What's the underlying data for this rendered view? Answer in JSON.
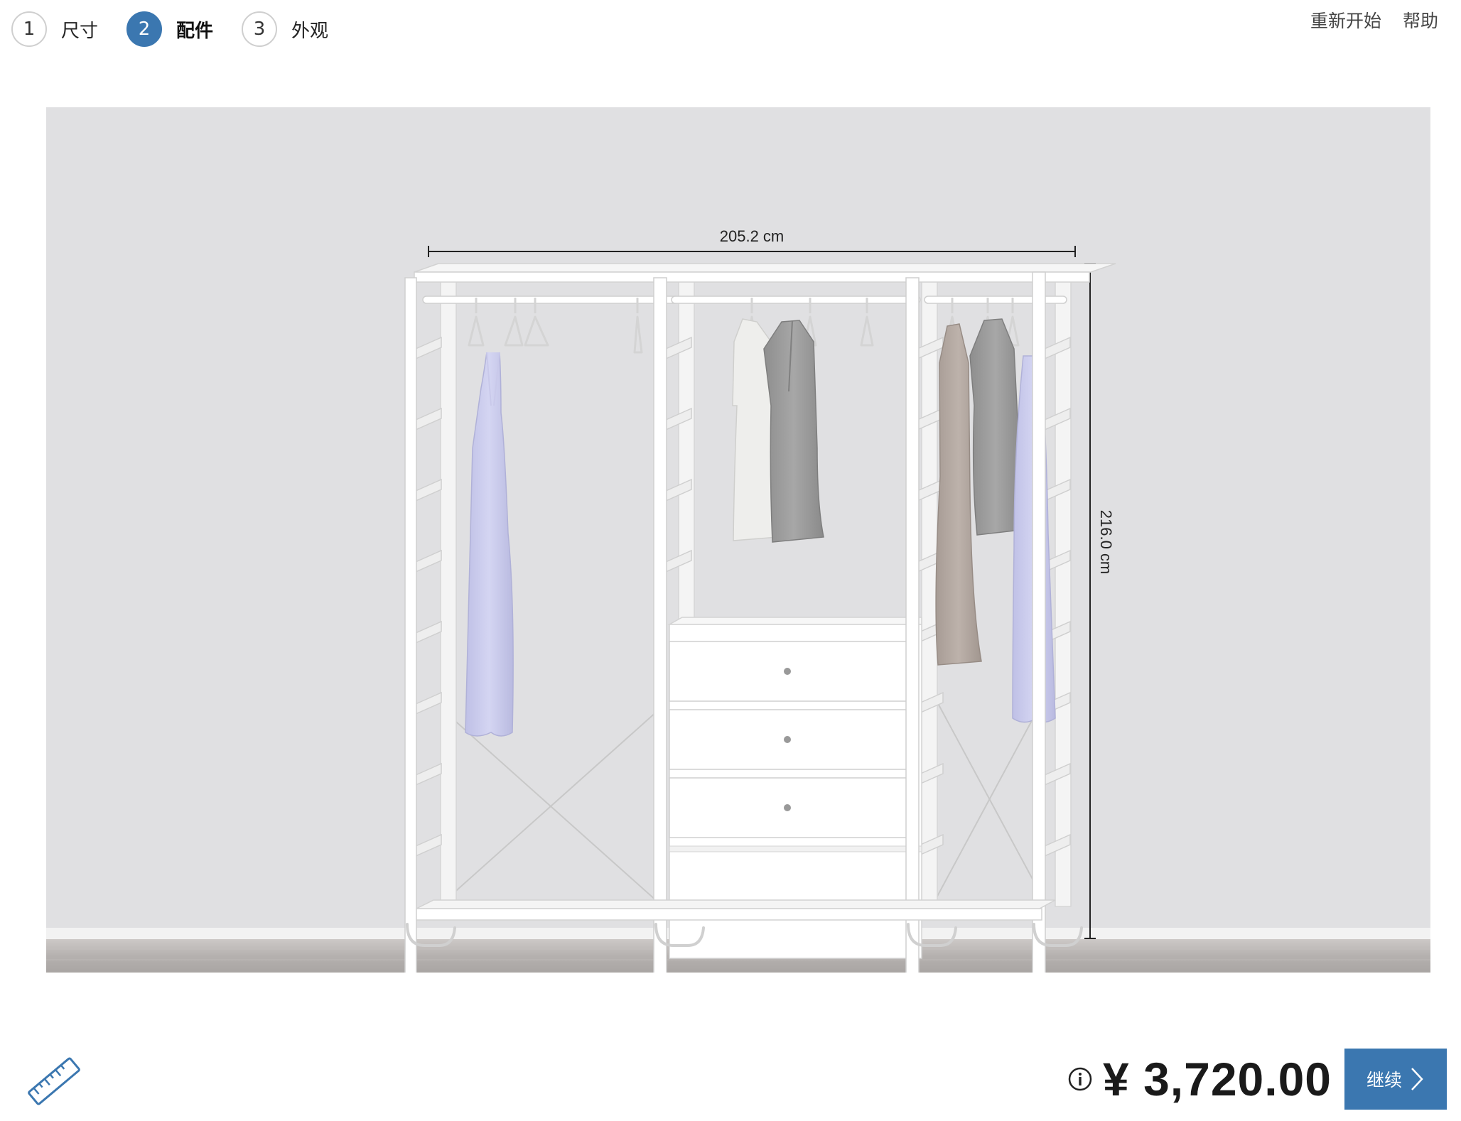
{
  "steps": [
    {
      "number": "1",
      "label": "尺寸",
      "active": false
    },
    {
      "number": "2",
      "label": "配件",
      "active": true
    },
    {
      "number": "3",
      "label": "外观",
      "active": false
    }
  ],
  "top_actions": {
    "restart": "重新开始",
    "help": "帮助"
  },
  "viewer": {
    "width_dimension": "205.2 cm",
    "height_dimension": "216.0 cm",
    "colors": {
      "wall": "#e0e0e2",
      "floor": "#b8b4b2",
      "frame": "#ffffff",
      "dress": "#c9c9ea",
      "shirt_light": "#ececea",
      "jacket_gray": "#9a9a9a",
      "dress_taupe": "#b5aaa4"
    }
  },
  "bottom": {
    "ruler_icon": "ruler-icon",
    "info_icon": "info-icon",
    "price": "¥ 3,720.00",
    "continue_label": "继续",
    "accent": "#3b77b0"
  }
}
